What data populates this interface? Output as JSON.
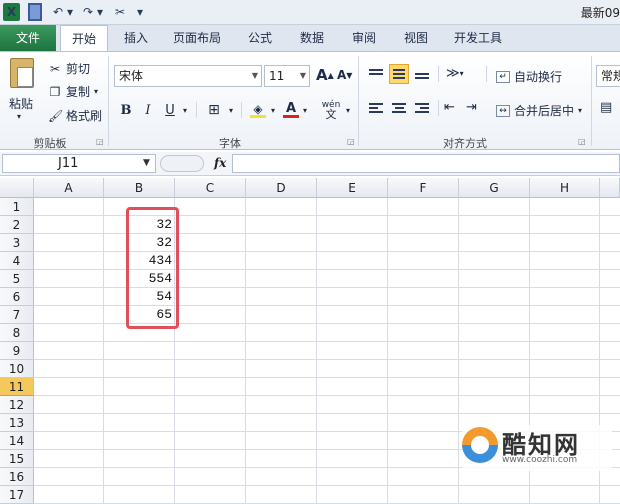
{
  "titlebar": {
    "app_logo": "X",
    "title": "最新09"
  },
  "tabs": [
    "文件",
    "开始",
    "插入",
    "页面布局",
    "公式",
    "数据",
    "审阅",
    "视图",
    "开发工具"
  ],
  "ribbon": {
    "clipboard": {
      "paste": "粘贴",
      "cut": "剪切",
      "copy": "复制",
      "format_painter": "格式刷",
      "group": "剪贴板"
    },
    "font": {
      "name": "宋体",
      "size": "11",
      "bold": "B",
      "italic": "I",
      "underline": "U",
      "grow": "A",
      "shrink": "A",
      "font_color": "A",
      "wen": "wén",
      "group": "字体"
    },
    "alignment": {
      "wrap_text": "自动换行",
      "merge_center": "合并后居中",
      "group": "对齐方式"
    },
    "number": {
      "format": "常规"
    }
  },
  "formula_bar": {
    "name_box": "J11",
    "fx": "fx",
    "formula": ""
  },
  "sheet": {
    "columns": [
      "A",
      "B",
      "C",
      "D",
      "E",
      "F",
      "G",
      "H"
    ],
    "rows": [
      "1",
      "2",
      "3",
      "4",
      "5",
      "6",
      "7",
      "8",
      "9",
      "10",
      "11",
      "12",
      "13",
      "14",
      "15",
      "16",
      "17"
    ],
    "selected_row": "11",
    "column_b_values": [
      "32",
      "32",
      "434",
      "554",
      "54",
      "65"
    ]
  },
  "watermark": {
    "brand": "酷知网",
    "url": "www.coozhi.com"
  },
  "colors": {
    "file_tab": "#217346",
    "highlight_border": "#e0505a",
    "selected_header": "#f5c85c"
  }
}
